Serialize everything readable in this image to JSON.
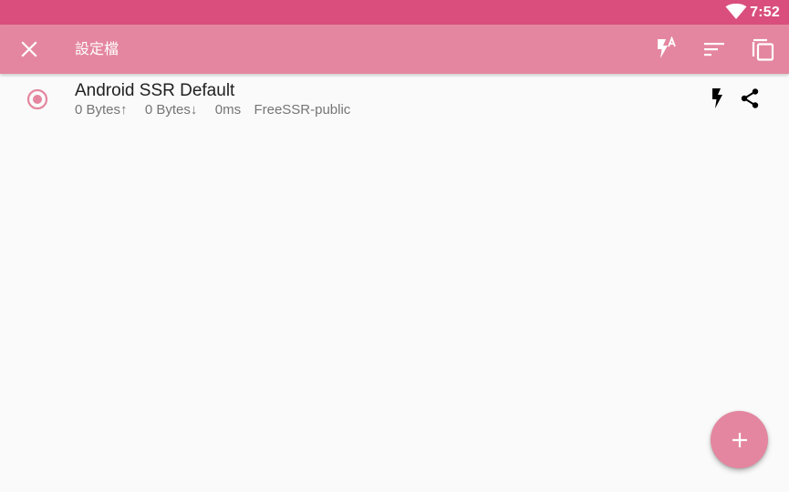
{
  "status_bar": {
    "time": "7:52",
    "wifi_icon": "wifi-icon"
  },
  "app_bar": {
    "title": "設定檔",
    "close_icon": "close-icon",
    "actions": [
      {
        "name": "test-all-latency",
        "icon": "flash-auto-icon"
      },
      {
        "name": "sort",
        "icon": "sort-icon"
      },
      {
        "name": "copy",
        "icon": "copy-icon"
      }
    ]
  },
  "profiles": [
    {
      "name": "Android SSR Default",
      "tx": "0 Bytes↑",
      "rx": "0 Bytes↓",
      "latency": "0ms",
      "group": "FreeSSR-public",
      "selected": true
    }
  ],
  "fab": {
    "icon": "plus-icon"
  },
  "colors": {
    "status_bar": "#d94e7c",
    "app_bar": "#e4869f",
    "accent": "#e4869f",
    "background": "#fafafa"
  }
}
